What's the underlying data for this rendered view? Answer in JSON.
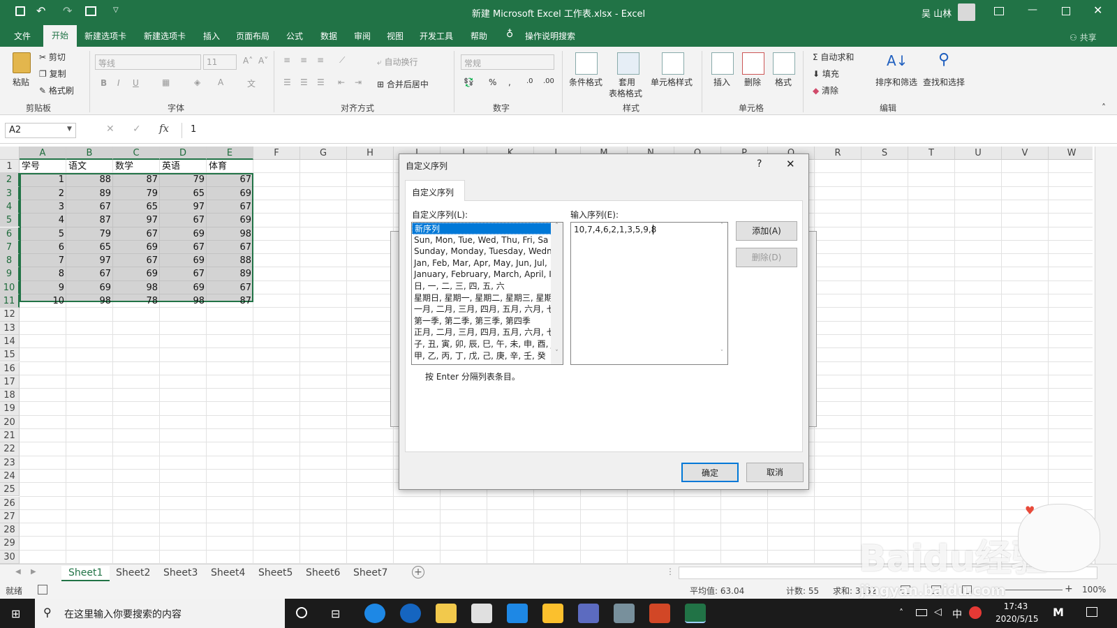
{
  "window": {
    "title": "新建 Microsoft Excel 工作表.xlsx - Excel",
    "user": "吴 山林"
  },
  "menu": {
    "items": [
      "文件",
      "开始",
      "新建选项卡",
      "新建选项卡",
      "插入",
      "页面布局",
      "公式",
      "数据",
      "审阅",
      "视图",
      "开发工具",
      "帮助"
    ],
    "active_index": 1,
    "tell_me": "操作说明搜索",
    "share": "共享"
  },
  "ribbon": {
    "clipboard": {
      "label": "剪贴板",
      "paste": "粘贴",
      "cut": "剪切",
      "copy": "复制",
      "format_painter": "格式刷"
    },
    "font": {
      "label": "字体",
      "font_name": "等线",
      "font_size": "11"
    },
    "alignment": {
      "label": "对齐方式",
      "wrap": "自动换行",
      "merge": "合并后居中"
    },
    "number": {
      "label": "数字",
      "format": "常规"
    },
    "styles": {
      "label": "样式",
      "conditional": "条件格式",
      "table1": "套用",
      "table2": "表格格式",
      "cell_styles": "单元格样式"
    },
    "cells": {
      "label": "单元格",
      "insert": "插入",
      "delete": "删除",
      "format": "格式"
    },
    "editing": {
      "label": "编辑",
      "autosum": "自动求和",
      "fill": "填充",
      "clear": "清除",
      "sort": "排序和筛选",
      "find": "查找和选择"
    }
  },
  "formula_bar": {
    "name_box": "A2",
    "value": "1"
  },
  "grid": {
    "columns": [
      "A",
      "B",
      "C",
      "D",
      "E",
      "F",
      "G",
      "H",
      "I",
      "J",
      "K",
      "L",
      "M",
      "N",
      "O",
      "P",
      "Q",
      "R",
      "S",
      "T",
      "U",
      "V",
      "W"
    ],
    "rows": [
      "1",
      "2",
      "3",
      "4",
      "5",
      "6",
      "7",
      "8",
      "9",
      "10",
      "11",
      "12",
      "13",
      "14",
      "15",
      "16",
      "17",
      "18",
      "19",
      "20",
      "21",
      "22",
      "23",
      "24",
      "25",
      "26",
      "27",
      "28",
      "29",
      "30"
    ],
    "headers": [
      "学号",
      "语文",
      "数学",
      "英语",
      "体育"
    ],
    "data": [
      [
        "1",
        "88",
        "87",
        "79",
        "67"
      ],
      [
        "2",
        "89",
        "79",
        "65",
        "69"
      ],
      [
        "3",
        "67",
        "65",
        "97",
        "67"
      ],
      [
        "4",
        "87",
        "97",
        "67",
        "69"
      ],
      [
        "5",
        "79",
        "67",
        "69",
        "98"
      ],
      [
        "6",
        "65",
        "69",
        "67",
        "67"
      ],
      [
        "7",
        "97",
        "67",
        "69",
        "88"
      ],
      [
        "8",
        "67",
        "69",
        "67",
        "89"
      ],
      [
        "9",
        "69",
        "98",
        "69",
        "67"
      ],
      [
        "10",
        "98",
        "78",
        "98",
        "87"
      ]
    ]
  },
  "sheets": {
    "tabs": [
      "Sheet1",
      "Sheet2",
      "Sheet3",
      "Sheet4",
      "Sheet5",
      "Sheet6",
      "Sheet7"
    ],
    "active_index": 0
  },
  "status": {
    "ready": "就绪",
    "average": "平均值: 63.04",
    "count": "计数: 55",
    "sum": "求和: 3152",
    "zoom": "100%"
  },
  "dialog": {
    "title": "自定义序列",
    "tab": "自定义序列",
    "list_label": "自定义序列(L):",
    "input_label": "输入序列(E):",
    "lists": [
      "新序列",
      "Sun, Mon, Tue, Wed, Thu, Fri, Sa",
      "Sunday, Monday, Tuesday, Wedn",
      "Jan, Feb, Mar, Apr, May, Jun, Jul,",
      "January, February, March, April, I",
      "日, 一, 二, 三, 四, 五, 六",
      "星期日, 星期一, 星期二, 星期三, 星期",
      "一月, 二月, 三月, 四月, 五月, 六月, 七",
      "第一季, 第二季, 第三季, 第四季",
      "正月, 二月, 三月, 四月, 五月, 六月, 七",
      "子, 丑, 寅, 卯, 辰, 巳, 午, 未, 申, 酉, J",
      "甲, 乙, 丙, 丁, 戊, 己, 庚, 辛, 壬, 癸"
    ],
    "selected_index": 0,
    "input_value": "10,7,4,6,2,1,3,5,9,8",
    "add_button": "添加(A)",
    "delete_button": "删除(D)",
    "hint": "按 Enter 分隔列表条目。",
    "ok_button": "确定",
    "cancel_button": "取消"
  },
  "taskbar": {
    "search_placeholder": "在这里输入你要搜索的内容",
    "time": "17:43",
    "date": "2020/5/15",
    "ime": "中"
  },
  "watermark": {
    "text": "Baidu经验",
    "url": "jingyan.baidu.com"
  }
}
